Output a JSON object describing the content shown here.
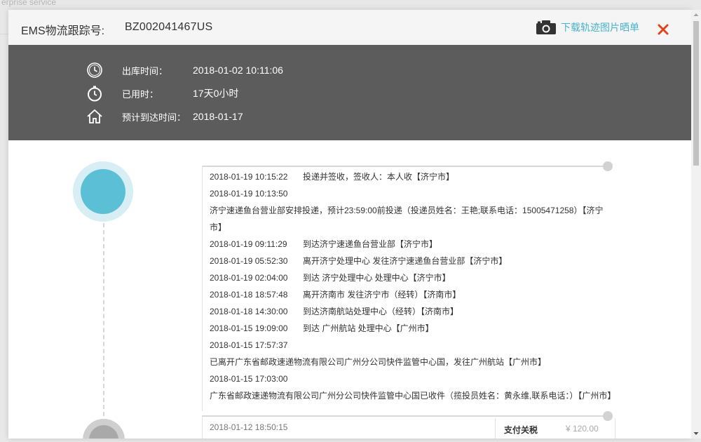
{
  "background": {
    "text": "erprise service"
  },
  "modal": {
    "title_label": "EMS物流跟踪号:",
    "tracking_number": "BZ002041467US",
    "download_label": "下载轨迹图片晒单",
    "download_icon": "camera-icon",
    "close_icon": "close-icon",
    "accent_color": "#47b3cc",
    "close_color": "#e2431b"
  },
  "info": {
    "outbound_label": "出库时间：",
    "outbound_value": "2018-01-02 10:11:06",
    "elapsed_label": "已用时：",
    "elapsed_value": "17天0小时",
    "eta_label": "预计到达时间：",
    "eta_value": "2018-01-17"
  },
  "tracking": [
    {
      "time": "2018-01-19 10:15:22",
      "desc": "投递并签收，签收人：本人收【济宁市】"
    },
    {
      "time": "2018-01-19 10:13:50",
      "desc": ""
    },
    {
      "time": "",
      "desc": "济宁速递鱼台营业部安排投递，预计23:59:00前投递（投递员姓名：王艳;联系电话：15005471258）【济宁市】"
    },
    {
      "time": "2018-01-19 09:11:29",
      "desc": "到达济宁速递鱼台营业部【济宁市】"
    },
    {
      "time": "2018-01-19 05:52:30",
      "desc": "离开济宁处理中心 发往济宁速递鱼台营业部【济宁市】"
    },
    {
      "time": "2018-01-19 02:04:00",
      "desc": "到达 济宁处理中心 处理中心【济宁市】"
    },
    {
      "time": "2018-01-18 18:57:48",
      "desc": "离开济南市 发往济宁市（经转）【济南市】"
    },
    {
      "time": "2018-01-18 14:30:00",
      "desc": "到达济南航站处理中心（经转）【济南市】"
    },
    {
      "time": "2018-01-15 19:09:00",
      "desc": "到达 广州航站 处理中心【广州市】"
    },
    {
      "time": "2018-01-15 17:57:37",
      "desc": ""
    },
    {
      "time": "",
      "desc": "已离开广东省邮政速递物流有限公司广州分公司快件监管中心国，发往广州航站【广州市】"
    },
    {
      "time": "2018-01-15 17:03:00",
      "desc": ""
    },
    {
      "time": "",
      "desc": "广东省邮政速递物流有限公司广州分公司快件监管中心国已收件（揽投员姓名：黄永维,联系电话：）【广州市】"
    }
  ],
  "second_section": {
    "time": "2018-01-12 18:50:15",
    "pay_label": "支付关税",
    "pay_value": "¥ 120.00"
  }
}
